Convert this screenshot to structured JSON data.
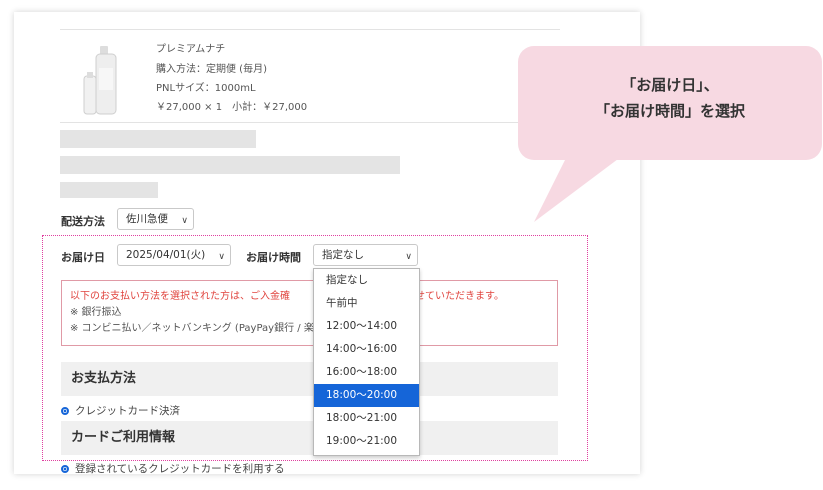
{
  "product": {
    "name": "プレミアムナチ",
    "purchase_method": "購入方法：定期便 (毎月)",
    "size": "PNLサイズ：1000mL",
    "price": "￥27,000 × 1　小計：￥27,000"
  },
  "shipping": {
    "method_label": "配送方法",
    "method_value": "佐川急便"
  },
  "delivery": {
    "date_label": "お届け日",
    "date_value": "2025/04/01(火)",
    "time_label": "お届け時間",
    "time_value": "指定なし",
    "time_options": [
      "指定なし",
      "午前中",
      "12:00〜14:00",
      "14:00〜16:00",
      "16:00〜18:00",
      "18:00〜20:00",
      "18:00〜21:00",
      "19:00〜21:00"
    ],
    "selected_index": 5
  },
  "notice": {
    "line1_start": "以下のお支払い方法を選択された方は、ご入金確",
    "line1_end": "させていただきます。",
    "line2": "※ 銀行振込",
    "line3": "※ コンビニ払い／ネットバンキング (PayPay銀行 / 楽"
  },
  "payment": {
    "heading": "お支払方法",
    "option_credit": "クレジットカード決済"
  },
  "card": {
    "heading": "カードご利用情報",
    "option_registered": "登録されているクレジットカードを利用する"
  },
  "callout": {
    "line1": "「お届け日」、",
    "line2": "「お届け時間」を選択"
  },
  "colors": {
    "accent": "#1565d8",
    "callout_bg": "#f7d9e2",
    "highlight_border": "#e040a0",
    "notice_text": "#e0443e"
  }
}
